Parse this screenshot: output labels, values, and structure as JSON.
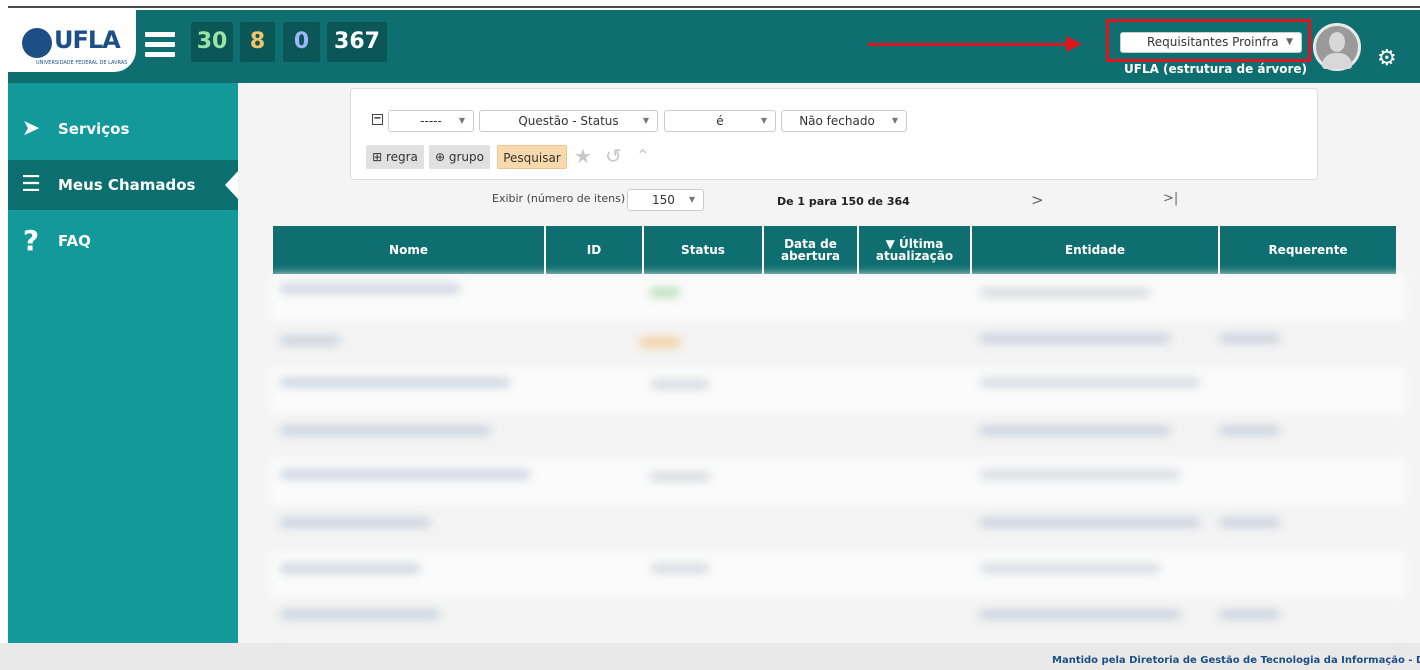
{
  "header": {
    "logo_text": "UFLA",
    "logo_subtitle": "UNIVERSIDADE FEDERAL DE LAVRAS",
    "counters": [
      {
        "value": "30",
        "color": "#9be3a5"
      },
      {
        "value": "8",
        "color": "#f2c36b"
      },
      {
        "value": "0",
        "color": "#9ab8f5"
      },
      {
        "value": "367",
        "color": "#ffffff"
      }
    ],
    "profile_select": "Requisitantes Proinfra",
    "entity_label": "UFLA (estrutura de árvore)"
  },
  "sidebar": {
    "items": [
      {
        "label": "Serviços",
        "icon": "paper-plane-icon"
      },
      {
        "label": "Meus Chamados",
        "icon": "list-check-icon"
      },
      {
        "label": "FAQ",
        "icon": "question-icon"
      }
    ]
  },
  "search": {
    "field_select": "-----",
    "criterion_select": "Questão - Status",
    "operator_select": "é",
    "value_select": "Não fechado",
    "rule_button": "regra",
    "group_button": "grupo",
    "search_button": "Pesquisar"
  },
  "pager": {
    "display_label": "Exibir (número de itens)",
    "page_size": "150",
    "range_info": "De 1 para 150 de 364",
    "next": ">",
    "last": ">|"
  },
  "table": {
    "columns": [
      "Nome",
      "ID",
      "Status",
      "Data de abertura",
      "▼ Última atualização",
      "Entidade",
      "Requerente"
    ]
  },
  "footer": {
    "text": "Mantido pela Diretoria de Gestão de Tecnologia da Informação - DG"
  },
  "colors": {
    "header_bg": "#0f6e6f",
    "sidebar_bg": "#14999a",
    "highlight": "#e0141e"
  }
}
